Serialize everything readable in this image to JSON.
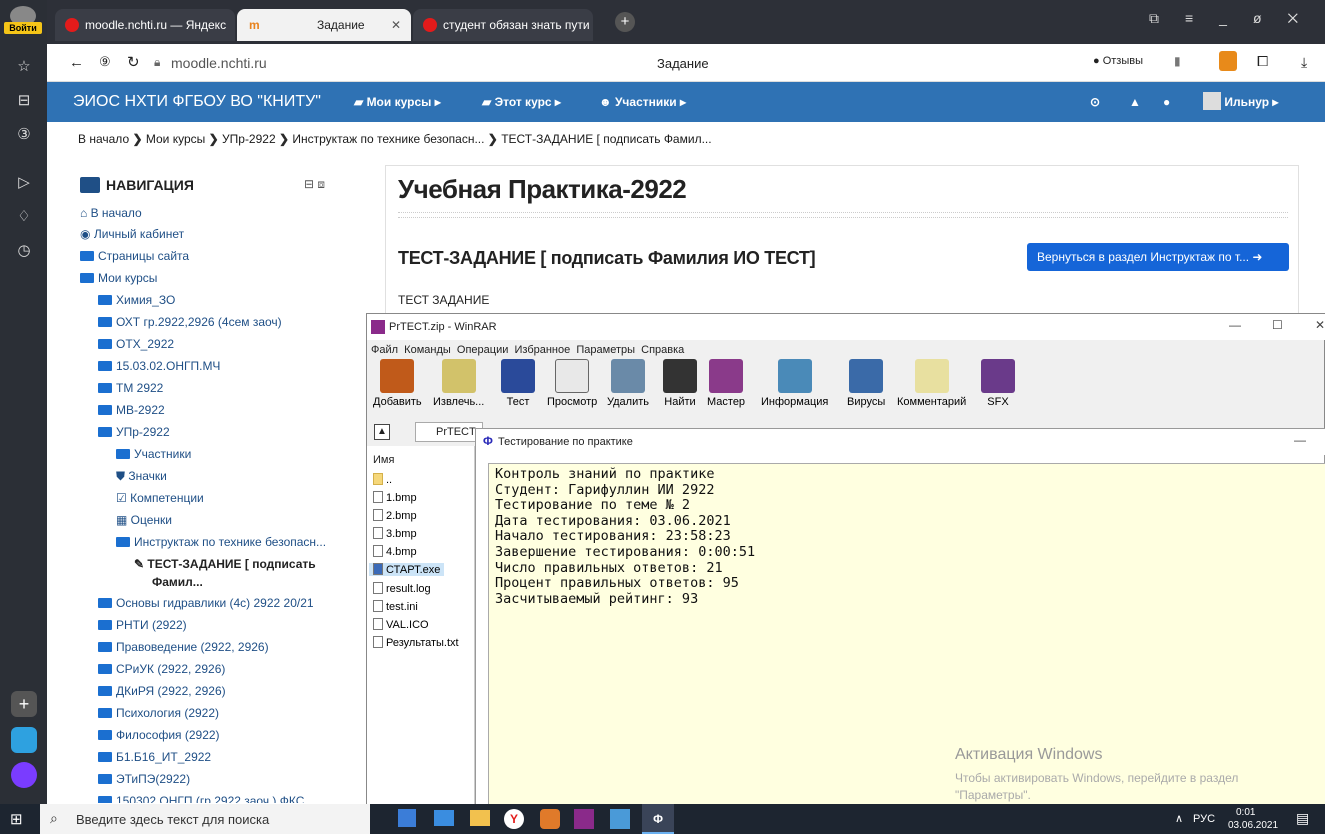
{
  "sidebar": {
    "login_label": "Войти"
  },
  "tabs": [
    {
      "label": "moodle.nchti.ru — Яндекс",
      "icon": "yandex-icon"
    },
    {
      "label": "Задание",
      "icon": "moodle-icon"
    },
    {
      "label": "студент обязан знать пути",
      "icon": "yandex-icon"
    }
  ],
  "urlbar": {
    "url": "moodle.nchti.ru",
    "page_title": "Задание",
    "reviews_label": "Отзывы"
  },
  "moodle_nav": {
    "site_name": "ЭИОС НХТИ ФГБОУ ВО \"КНИТУ\"",
    "my_courses": "Мои курсы",
    "this_course": "Этот курс",
    "participants": "Участники",
    "user": "Ильнур"
  },
  "breadcrumb": [
    "В начало",
    "Мои курсы",
    "УПр-2922",
    "Инструктаж по технике безопасн...",
    "ТЕСТ-ЗАДАНИЕ [ подписать Фамил..."
  ],
  "navigation": {
    "title": "НАВИГАЦИЯ",
    "items": [
      {
        "label": "В начало"
      },
      {
        "label": "Личный кабинет"
      },
      {
        "label": "Страницы сайта"
      },
      {
        "label": "Мои курсы"
      },
      {
        "label": "Химия_ЗО"
      },
      {
        "label": "ОХТ гр.2922,2926 (4сем заоч)"
      },
      {
        "label": "ОТХ_2922"
      },
      {
        "label": "15.03.02.ОНГП.МЧ"
      },
      {
        "label": "ТМ 2922"
      },
      {
        "label": "МВ-2922"
      },
      {
        "label": "УПр-2922"
      },
      {
        "label": "Участники"
      },
      {
        "label": "Значки"
      },
      {
        "label": "Компетенции"
      },
      {
        "label": "Оценки"
      },
      {
        "label": "Инструктаж по технике безопасн..."
      },
      {
        "label": "ТЕСТ-ЗАДАНИЕ [ подписать"
      },
      {
        "label": "Фамил..."
      },
      {
        "label": "Основы гидравлики (4с) 2922 20/21"
      },
      {
        "label": "РНТИ (2922)"
      },
      {
        "label": "Правоведение (2922, 2926)"
      },
      {
        "label": "СРиУК (2922, 2926)"
      },
      {
        "label": "ДКиРЯ (2922, 2926)"
      },
      {
        "label": "Психология (2922)"
      },
      {
        "label": "Философия (2922)"
      },
      {
        "label": "Б1.Б16_ИТ_2922"
      },
      {
        "label": "ЭТиПЭ(2922)"
      },
      {
        "label": "150302.ОНГП (гр.2922 заоч.) ФКС"
      }
    ]
  },
  "main": {
    "course_title": "Учебная Практика-2922",
    "task_title": "ТЕСТ-ЗАДАНИЕ [ подписать Фамилия ИО ТЕСТ]",
    "return_button": "Вернуться в раздел Инструктаж по т...",
    "description": "ТЕСТ ЗАДАНИЕ"
  },
  "winrar": {
    "title": "PrTECT.zip - WinRAR",
    "menu": [
      "Файл",
      "Команды",
      "Операции",
      "Избранное",
      "Параметры",
      "Справка"
    ],
    "tools": [
      "Добавить",
      "Извлечь...",
      "Тест",
      "Просмотр",
      "Удалить",
      "Найти",
      "Мастер",
      "Информация",
      "Вирусы",
      "Комментарий",
      "SFX"
    ],
    "path": "PrTECT.z",
    "column_name": "Имя",
    "files": [
      "..",
      "1.bmp",
      "2.bmp",
      "3.bmp",
      "4.bmp",
      "СТАРТ.exe",
      "result.log",
      "test.ini",
      "VAL.ICO",
      "Результаты.txt"
    ]
  },
  "test_window": {
    "title": "Тестирование по практике",
    "lines": [
      "Контроль знаний по практике",
      "Студент: Гарифуллин ИИ 2922",
      "Тестирование по теме № 2",
      "Дата тестирования: 03.06.2021",
      "Начало тестирования: 23:58:23",
      "Завершение тестирования: 0:00:51",
      "Число правильных ответов: 21",
      "Процент правильных ответов: 95",
      "Засчитываемый рейтинг: 93"
    ]
  },
  "activation": {
    "title": "Активация Windows",
    "line1": "Чтобы активировать Windows, перейдите в раздел",
    "line2": "\"Параметры\"."
  },
  "taskbar": {
    "search_placeholder": "Введите здесь текст для поиска",
    "lang": "РУС",
    "time": "0:01",
    "date": "03.06.2021"
  }
}
